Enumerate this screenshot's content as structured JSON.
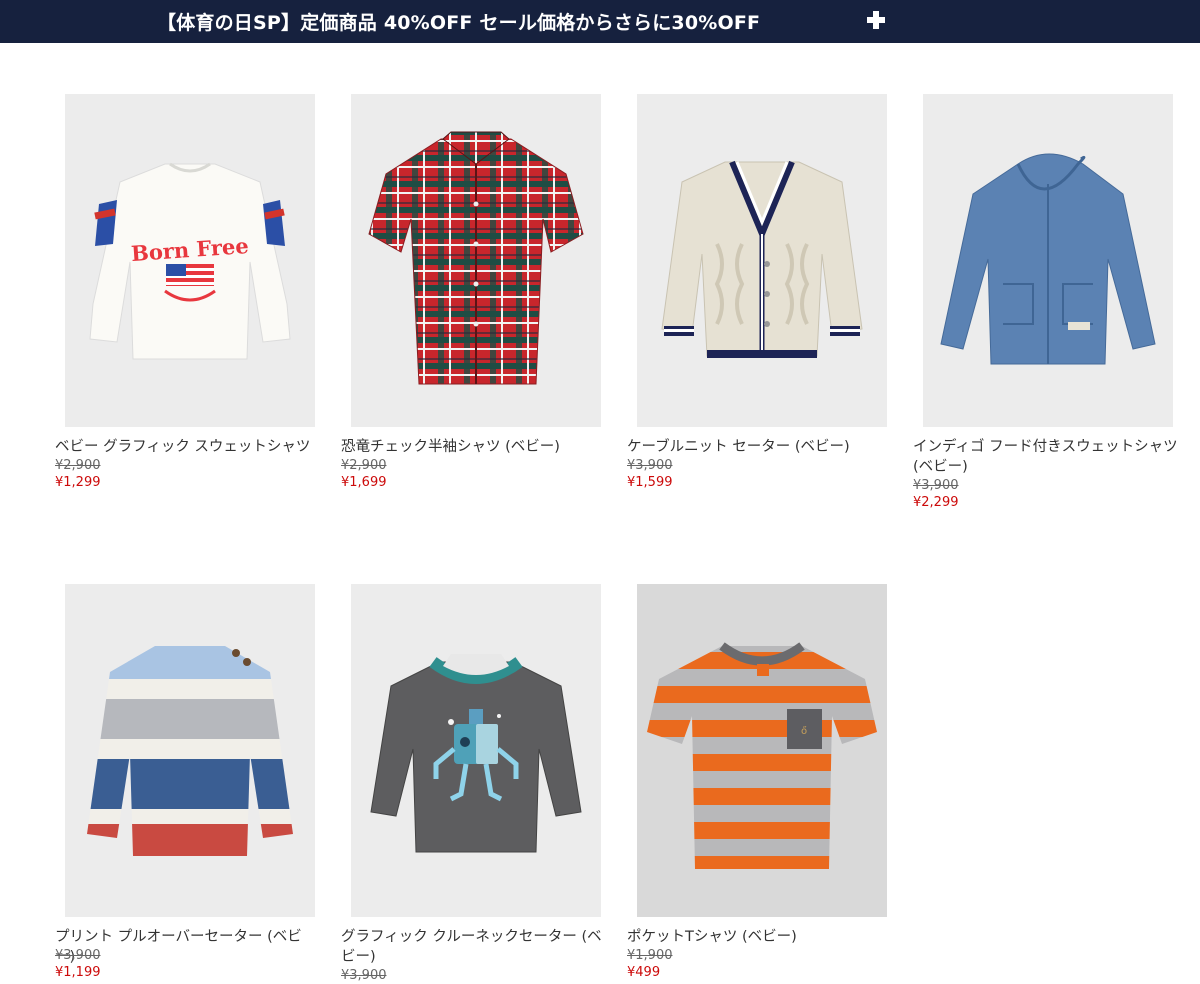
{
  "banner": {
    "text": "【体育の日SP】定価商品 40%OFF セール価格からさらに30%OFF",
    "icon": "plus-icon"
  },
  "products": [
    {
      "name": "ベビー グラフィック スウェットシャツ",
      "list_price": "¥2,900",
      "sale_price": "¥1,299"
    },
    {
      "name": "恐竜チェック半袖シャツ (ベビー)",
      "list_price": "¥2,900",
      "sale_price": "¥1,699"
    },
    {
      "name": "ケーブルニット セーター (ベビー)",
      "list_price": "¥3,900",
      "sale_price": "¥1,599"
    },
    {
      "name": "インディゴ フード付きスウェットシャツ (ベビー)",
      "list_price": "¥3,900",
      "sale_price": "¥2,299"
    },
    {
      "name": "プリント プルオーバーセーター (ベビー)",
      "list_price": "¥3,900",
      "sale_price": "¥1,199"
    },
    {
      "name": "グラフィック クルーネックセーター (ベビー)",
      "list_price": "¥3,900",
      "sale_price": ""
    },
    {
      "name": "ポケットTシャツ (ベビー)",
      "list_price": "¥1,900",
      "sale_price": "¥499"
    }
  ],
  "colors": {
    "banner": "#16213e",
    "sale": "#cc0a0a",
    "thumb_bg": "#ebebeb"
  }
}
